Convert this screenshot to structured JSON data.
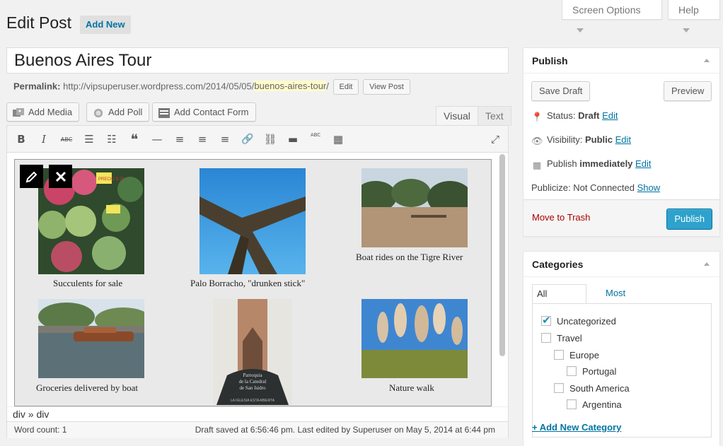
{
  "top_tabs": {
    "screen_options": "Screen Options",
    "help": "Help"
  },
  "header": {
    "title": "Edit Post",
    "add_new": "Add New"
  },
  "post": {
    "title": "Buenos Aires Tour",
    "permalink_label": "Permalink:",
    "permalink_base": "http://vipsuperuser.wordpress.com/2014/05/05/",
    "permalink_slug": "buenos-aires-tour",
    "permalink_trail": "/",
    "edit_btn": "Edit",
    "view_post_btn": "View Post"
  },
  "media_buttons": {
    "add_media": "Add Media",
    "add_poll": "Add Poll",
    "add_contact_form": "Add Contact Form"
  },
  "editor_tabs": {
    "visual": "Visual",
    "text": "Text"
  },
  "toolbar_icons": [
    "bold-icon",
    "italic-icon",
    "strikethrough-icon",
    "bullet-list-icon",
    "numbered-list-icon",
    "blockquote-icon",
    "horizontal-rule-icon",
    "align-left-icon",
    "align-center-icon",
    "align-right-icon",
    "link-icon",
    "unlink-icon",
    "read-more-icon",
    "spellcheck-icon",
    "toolbar-toggle-icon",
    "fullscreen-icon"
  ],
  "toolbar_glyphs": {
    "bold": "B",
    "italic": "I",
    "strike": "ABC",
    "bullets": "☰",
    "numbers": "☷",
    "quote": "❝",
    "hr": "—",
    "left": "≡",
    "center": "≡",
    "right": "≡",
    "link": "🔗",
    "unlink": "⛓",
    "more": "▬",
    "abc": "ABC",
    "kitchen": "▦",
    "full": "⤢"
  },
  "gallery": {
    "items": [
      {
        "caption": "Succulents for sale"
      },
      {
        "caption": "Palo Borracho, \"drunken stick\""
      },
      {
        "caption": "Boat rides on the Tigre River"
      },
      {
        "caption": "Groceries delivered by boat"
      },
      {
        "caption": ""
      },
      {
        "caption": "Nature walk"
      }
    ],
    "church_sign": "Parroquia de la Catedral de San Isidro",
    "church_sign_lines": [
      "Parroquia",
      "de la Catedral",
      "de San Isidro"
    ],
    "church_footer": "LA IGLESIA ESTA ABIERTA",
    "price_tag": "PRECIO $ 25"
  },
  "editor_status": {
    "path": "div » div",
    "word_count": "Word count: 1",
    "saved": "Draft saved at 6:56:46 pm. Last edited by Superuser on May 5, 2014 at 6:44 pm"
  },
  "publish_box": {
    "title": "Publish",
    "save_draft": "Save Draft",
    "preview": "Preview",
    "status_label": "Status:",
    "status_value": "Draft",
    "visibility_label": "Visibility:",
    "visibility_value": "Public",
    "publish_label": "Publish",
    "publish_value": "immediately",
    "edit_link": "Edit",
    "publicize_label": "Publicize: Not Connected",
    "publicize_link": "Show",
    "move_to_trash": "Move to Trash",
    "publish_btn": "Publish"
  },
  "categories_box": {
    "title": "Categories",
    "tab_all": "All Categories",
    "tab_most_used": "Most Used",
    "items": [
      {
        "label": "Uncategorized",
        "checked": true,
        "level": 0
      },
      {
        "label": "Travel",
        "checked": false,
        "level": 0
      },
      {
        "label": "Europe",
        "checked": false,
        "level": 1
      },
      {
        "label": "Portugal",
        "checked": false,
        "level": 2
      },
      {
        "label": "South America",
        "checked": false,
        "level": 1
      },
      {
        "label": "Argentina",
        "checked": false,
        "level": 2
      }
    ],
    "add_new": "+ Add New Category"
  },
  "colors": {
    "link": "#0074a2",
    "publish": "#2ea2cc",
    "trash": "#aa0000",
    "slug_highlight": "#fffbcc"
  }
}
